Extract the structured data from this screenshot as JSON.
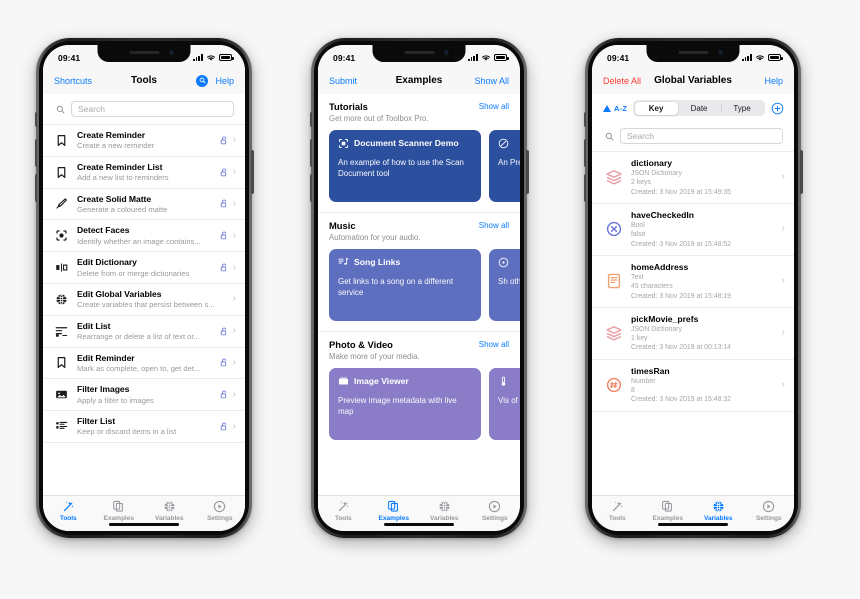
{
  "status_bar": {
    "time": "09:41"
  },
  "phone1": {
    "nav": {
      "left": "Shortcuts",
      "title": "Tools",
      "right": "Help",
      "search_icon": "search-icon"
    },
    "search": {
      "placeholder": "Search"
    },
    "tools": [
      {
        "title": "Create Reminder",
        "subtitle": "Create a new reminder",
        "icon": "bookmark-icon",
        "locked": true
      },
      {
        "title": "Create Reminder List",
        "subtitle": "Add a new list to reminders",
        "icon": "bookmark-icon",
        "locked": true
      },
      {
        "title": "Create Solid Matte",
        "subtitle": "Generate a coloured matte",
        "icon": "brush-icon",
        "locked": true
      },
      {
        "title": "Detect Faces",
        "subtitle": "Identify whether an image contains...",
        "icon": "face-detect-icon",
        "locked": true
      },
      {
        "title": "Edit Dictionary",
        "subtitle": "Delete from or merge dictionaries",
        "icon": "dictionary-icon",
        "locked": true
      },
      {
        "title": "Edit Global Variables",
        "subtitle": "Create variables that persist between s...",
        "icon": "globe-icon",
        "locked": false
      },
      {
        "title": "Edit List",
        "subtitle": "Rearrange or delete a list of text or...",
        "icon": "list-icon",
        "locked": true
      },
      {
        "title": "Edit Reminder",
        "subtitle": "Mark as complete, open to, get det...",
        "icon": "bookmark-icon",
        "locked": true
      },
      {
        "title": "Filter Images",
        "subtitle": "Apply a filter to images",
        "icon": "image-icon",
        "locked": true
      },
      {
        "title": "Filter List",
        "subtitle": "Keep or discard items in a list",
        "icon": "filter-list-icon",
        "locked": true
      }
    ],
    "tabs": [
      {
        "label": "Tools",
        "icon": "wand-icon",
        "active": true
      },
      {
        "label": "Examples",
        "icon": "documents-icon",
        "active": false
      },
      {
        "label": "Variables",
        "icon": "globe-icon",
        "active": false
      },
      {
        "label": "Settings",
        "icon": "play-circle-icon",
        "active": false
      }
    ]
  },
  "phone2": {
    "nav": {
      "left": "Submit",
      "title": "Examples",
      "right": "Show All"
    },
    "sections": [
      {
        "title": "Tutorials",
        "subtitle": "Get more out of Toolbox Pro.",
        "show_all": "Show all",
        "cards": [
          {
            "title": "Document Scanner Demo",
            "body": "An example of how to use the Scan Document tool",
            "color": "#2c4f9e",
            "icon": "scan-icon",
            "width": "w1"
          },
          {
            "title": "",
            "body": "An Pre",
            "color": "#2c4f9e",
            "icon": "slash-circle-icon",
            "width": "w2"
          }
        ]
      },
      {
        "title": "Music",
        "subtitle": "Automation for your audio.",
        "show_all": "Show all",
        "cards": [
          {
            "title": "Song Links",
            "body": "Get links to a song on a different service",
            "color": "#5e6fc0",
            "icon": "music-list-icon",
            "width": "w1"
          },
          {
            "title": "",
            "body": "Sh oth",
            "color": "#5e6fc0",
            "icon": "album-icon",
            "width": "w2"
          }
        ]
      },
      {
        "title": "Photo & Video",
        "subtitle": "Make more of your media.",
        "show_all": "Show all",
        "cards": [
          {
            "title": "Image Viewer",
            "body": "Preview image metadata with live map",
            "color": "#8b7cc8",
            "icon": "photos-icon",
            "width": "w1"
          },
          {
            "title": "",
            "body": "Vis of",
            "color": "#8b7cc8",
            "icon": "thermometer-icon",
            "width": "w2"
          }
        ]
      }
    ],
    "tabs": [
      {
        "label": "Tools",
        "icon": "wand-icon",
        "active": false
      },
      {
        "label": "Examples",
        "icon": "documents-icon",
        "active": true
      },
      {
        "label": "Variables",
        "icon": "globe-icon",
        "active": false
      },
      {
        "label": "Settings",
        "icon": "play-circle-icon",
        "active": false
      }
    ]
  },
  "phone3": {
    "nav": {
      "left": "Delete All",
      "title": "Global Variables",
      "right": "Help"
    },
    "sort": {
      "label": "A-Z",
      "direction_icon": "triangle-up-icon"
    },
    "segments": [
      {
        "label": "Key",
        "active": true
      },
      {
        "label": "Date",
        "active": false
      },
      {
        "label": "Type",
        "active": false
      }
    ],
    "add_button_icon": "plus-circle-icon",
    "search": {
      "placeholder": "Search"
    },
    "variables": [
      {
        "name": "dictionary",
        "type": "JSON Dictionary",
        "value": "2 keys",
        "created": "Created: 3 Nov 2019 at 15:49:35",
        "icon": "layers-icon",
        "color": "#e8a0a6"
      },
      {
        "name": "haveCheckedIn",
        "type": "Bool",
        "value": "false",
        "created": "Created: 3 Nov 2019 at 15:48:52",
        "icon": "x-circle-icon",
        "color": "#6a73d6"
      },
      {
        "name": "homeAddress",
        "type": "Text",
        "value": "45 characters",
        "created": "Created: 3 Nov 2019 at 15:48:19",
        "icon": "text-doc-icon",
        "color": "#f0a070"
      },
      {
        "name": "pickMovie_prefs",
        "type": "JSON Dictionary",
        "value": "1 key",
        "created": "Created: 3 Nov 2019 at 00:13:14",
        "icon": "layers-icon",
        "color": "#e8a0a6"
      },
      {
        "name": "timesRan",
        "type": "Number",
        "value": "8",
        "created": "Created: 3 Nov 2019 at 15:48:32",
        "icon": "hash-circle-icon",
        "color": "#f08060"
      }
    ],
    "tabs": [
      {
        "label": "Tools",
        "icon": "wand-icon",
        "active": false
      },
      {
        "label": "Examples",
        "icon": "documents-icon",
        "active": false
      },
      {
        "label": "Variables",
        "icon": "globe-icon",
        "active": true
      },
      {
        "label": "Settings",
        "icon": "play-circle-icon",
        "active": false
      }
    ]
  },
  "theme": {
    "accent_blue": "#0b7bfb",
    "destructive_red": "#fb3b30",
    "lock_purple": "#6a73d6",
    "tutorial_card": "#2c4f9e",
    "music_card": "#5e6fc0",
    "photo_card": "#8b7cc8"
  }
}
